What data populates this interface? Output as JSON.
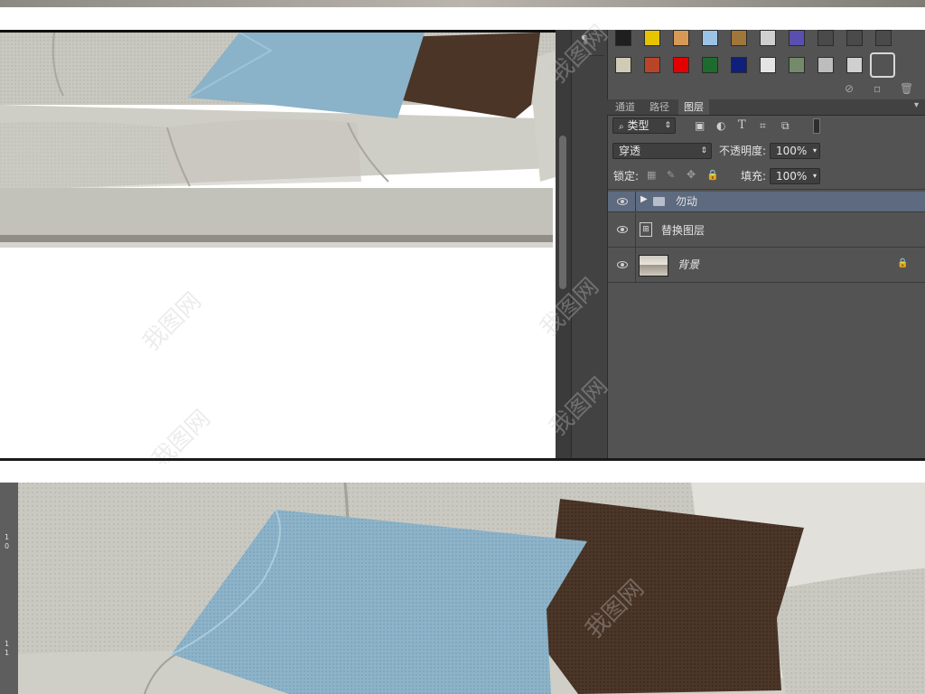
{
  "layers_panel": {
    "tabs": [
      "通道",
      "路径",
      "图层"
    ],
    "filter_kind": "类型",
    "blend_mode": "穿透",
    "opacity_label": "不透明度:",
    "opacity_value": "100%",
    "lock_label": "锁定:",
    "fill_label": "填充:",
    "fill_value": "100%",
    "layers": [
      {
        "name": "勿动",
        "type": "group",
        "selected": true
      },
      {
        "name": "替换图层",
        "type": "smart-object",
        "selected": false
      },
      {
        "name": "背景",
        "type": "background",
        "selected": false,
        "locked": true
      }
    ]
  },
  "ruler": {
    "marks": [
      "1",
      "0",
      "1",
      "1"
    ]
  },
  "colors": {
    "panel_bg": "#535353",
    "selected_layer": "#5d6a7f",
    "accent_blue_pillow": "#8ab2c9",
    "brown_pillow": "#4a3526",
    "sofa_fabric": "#cfcfc7"
  }
}
